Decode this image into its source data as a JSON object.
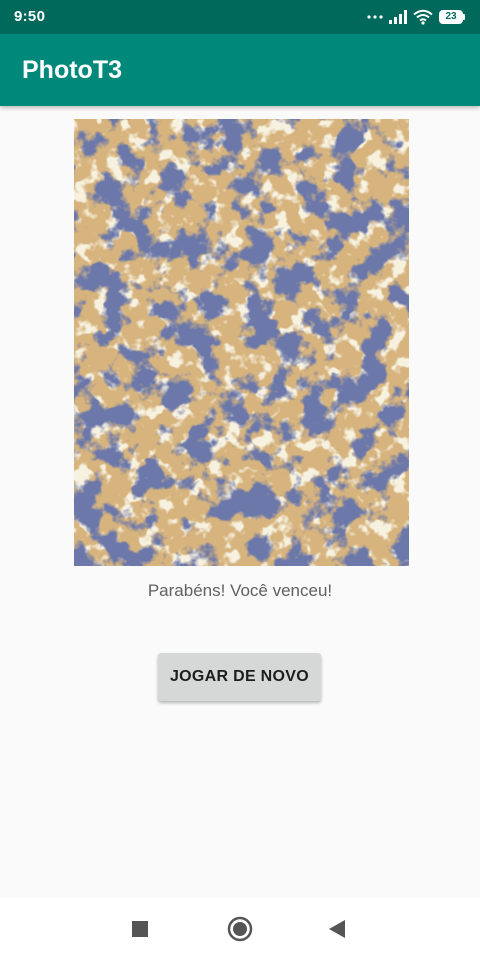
{
  "status_bar": {
    "time": "9:50",
    "battery_level": "23",
    "icons": [
      "dots-icon",
      "signal-icon",
      "wifi-icon",
      "battery-icon"
    ],
    "background_color": "#00695c"
  },
  "app_bar": {
    "title": "PhotoT3",
    "background_color": "#00897b"
  },
  "main": {
    "image_icon": "puzzle-image-marble-texture",
    "message": "Parabéns! Você venceu!",
    "play_again_label": "JOGAR DE NOVO"
  },
  "nav_bar": {
    "icons": [
      "recents-icon",
      "home-icon",
      "back-icon"
    ]
  }
}
